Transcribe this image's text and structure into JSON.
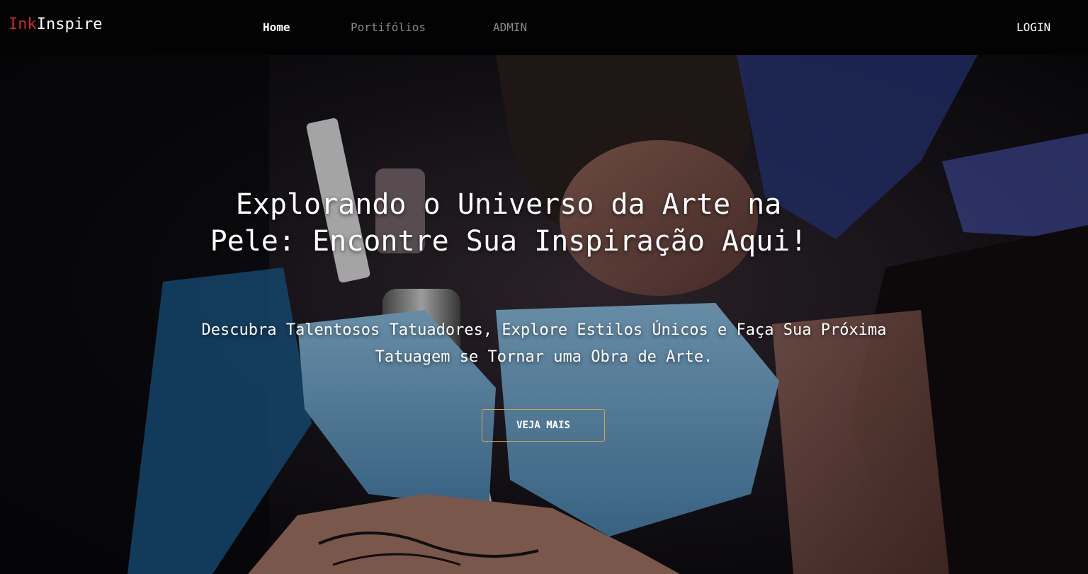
{
  "brand": {
    "part1": "Ink",
    "part2": "Inspire",
    "accent_color": "#d0282c"
  },
  "nav": {
    "home": "Home",
    "portfolios": "Portifólios",
    "admin": "ADMIN",
    "login": "LOGIN"
  },
  "hero": {
    "title": "Explorando o Universo da Arte na Pele: Encontre Sua Inspiração Aqui!",
    "subtitle": "Descubra Talentosos Tatuadores, Explore Estilos Únicos e Faça Sua Próxima Tatuagem se Tornar uma Obra de Arte.",
    "cta_label": "VEJA MAIS",
    "cta_border_color": "#d9a441"
  }
}
